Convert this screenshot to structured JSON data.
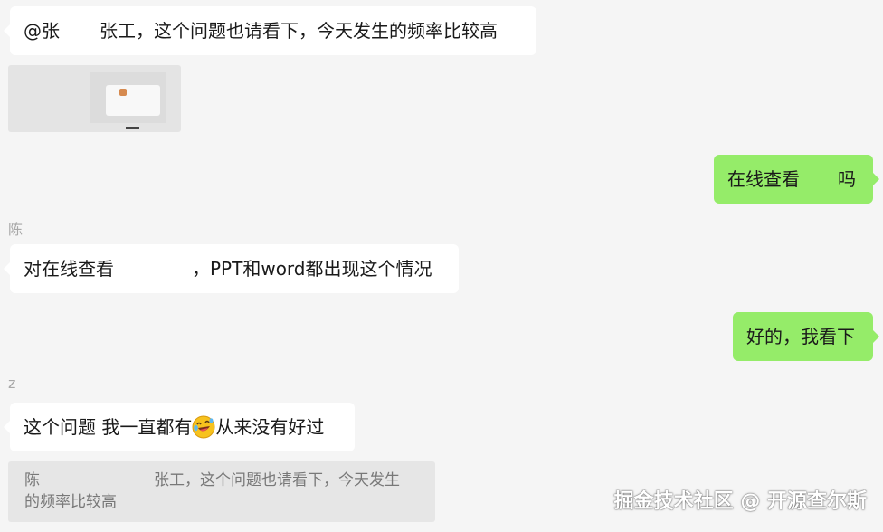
{
  "messages": {
    "m1": {
      "prefix": "@张",
      "text": "张工，这个问题也请看下，今天发生的频率比较高"
    },
    "m2": {
      "part1": "在线查看",
      "part2": "吗"
    },
    "m3": {
      "sender": "陈",
      "part1": "对在线查看",
      "part2": "，PPT和word都出现这个情况"
    },
    "m4": {
      "text": "好的，我看下"
    },
    "m5": {
      "sender": "z",
      "part1": "这个问题 我一直都有",
      "emoji": "rolling-on-floor-laughing-emoji",
      "part2": "从来没有好过"
    }
  },
  "quote": {
    "sender": "陈",
    "line1_rest": "张工，这个问题也请看下，今天发生",
    "line2": "的频率比较高"
  },
  "watermark": "掘金技术社区 @ 开源查尔斯",
  "colors": {
    "background": "#f5f5f5",
    "incoming_bubble": "#ffffff",
    "outgoing_bubble": "#95ec69",
    "quote_bg": "#e6e6e6"
  }
}
